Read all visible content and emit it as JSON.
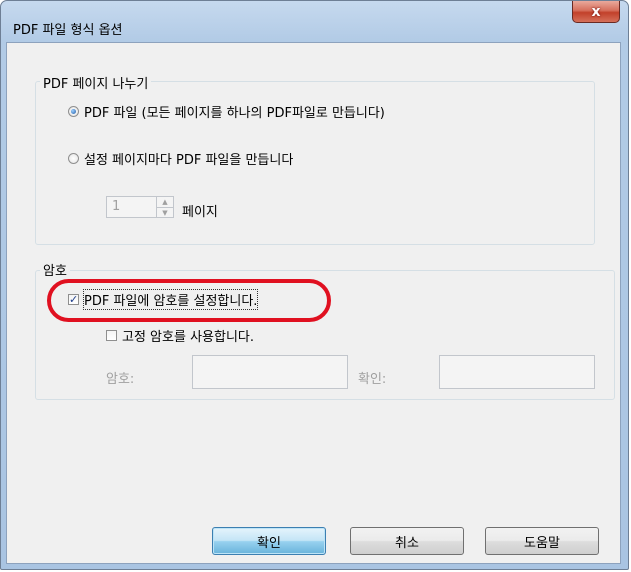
{
  "window": {
    "title": "PDF 파일 형식 옵션",
    "close_label": "x"
  },
  "split_group": {
    "legend": "PDF 페이지 나누기",
    "option_single": "PDF 파일 (모든 페이지를 하나의 PDF파일로 만듭니다)",
    "option_single_selected": true,
    "option_per_pages": "설정 페이지마다 PDF 파일을 만듭니다",
    "page_count_value": "1",
    "page_unit_label": "페이지"
  },
  "password_group": {
    "legend": "암호",
    "set_password_label": "PDF 파일에 암호를 설정합니다.",
    "set_password_checked": true,
    "fixed_password_label": "고정 암호를 사용합니다.",
    "fixed_password_checked": false,
    "password_label": "암호:",
    "confirm_label": "확인:",
    "password_value": "",
    "confirm_value": ""
  },
  "buttons": {
    "ok": "확인",
    "cancel": "취소",
    "help": "도움말"
  },
  "colors": {
    "highlight": "#e01020",
    "titlebar": "#b2cbe6",
    "close": "#c2402a"
  }
}
